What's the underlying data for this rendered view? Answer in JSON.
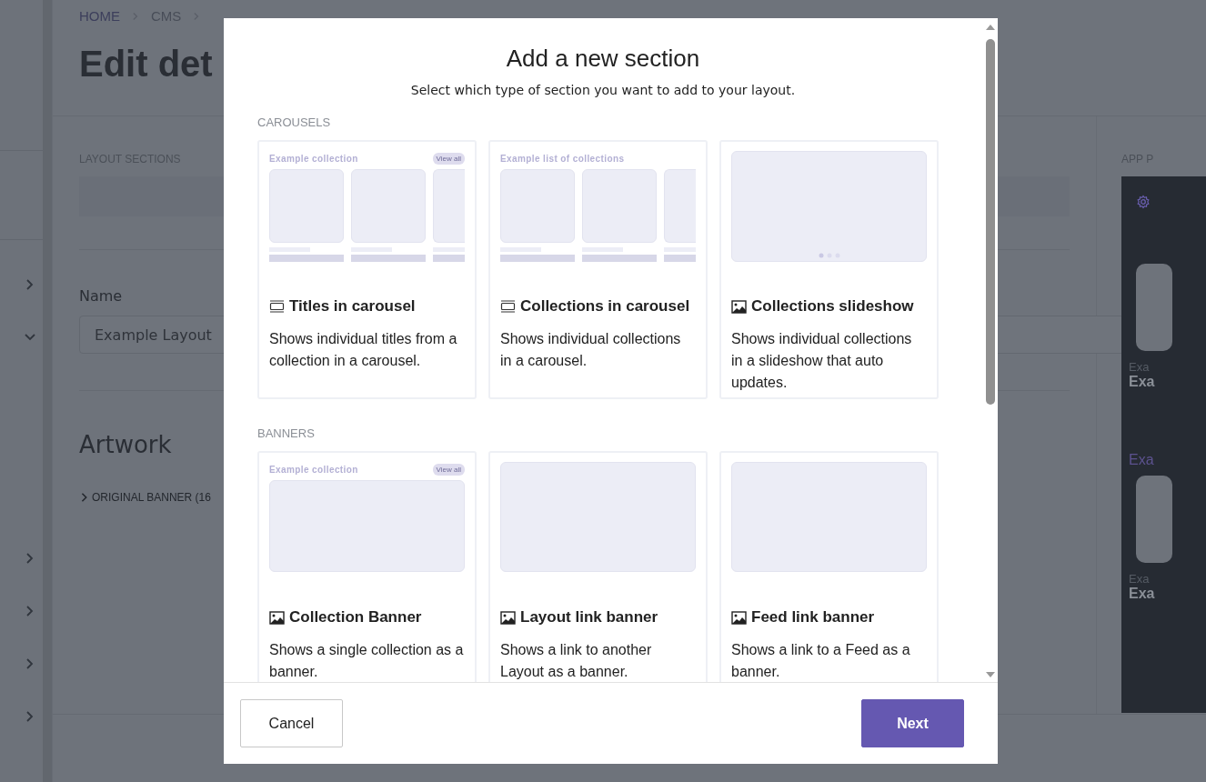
{
  "sidebar": {
    "items": [
      {
        "expanded": false
      },
      {
        "expanded": true
      },
      {
        "expanded": false
      },
      {
        "expanded": false
      },
      {
        "expanded": false
      },
      {
        "expanded": false
      }
    ]
  },
  "breadcrumbs": [
    {
      "label": "HOME",
      "link": true
    },
    {
      "label": "CMS",
      "link": false
    }
  ],
  "page_title": "Edit det",
  "layout_sections": {
    "label": "LAYOUT SECTIONS"
  },
  "name_field": {
    "label": "Name",
    "value": "Example Layout"
  },
  "artwork": {
    "heading": "Artwork",
    "items": [
      {
        "label": "ORIGINAL BANNER (16",
        "expanded": false
      }
    ]
  },
  "app_preview": {
    "label": "APP P",
    "rows": [
      {
        "kind": "tile"
      },
      {
        "kind": "caption",
        "text": "Exa"
      },
      {
        "kind": "title",
        "text": "Exa"
      },
      {
        "kind": "heading",
        "text": "Exa"
      },
      {
        "kind": "tile"
      },
      {
        "kind": "caption",
        "text": "Exa"
      },
      {
        "kind": "title",
        "text": "Exa"
      }
    ]
  },
  "modal": {
    "title": "Add a new section",
    "subtitle": "Select which type of section you want to add to your layout.",
    "groups": [
      {
        "label": "CAROUSELS",
        "sections": [
          {
            "kind": "carousel",
            "title": "Titles in carousel",
            "description": "Shows individual titles from a collection in a carousel.",
            "preview": {
              "kind": "carousel",
              "heading": "Example collection",
              "view_all": "View all"
            }
          },
          {
            "kind": "carousel",
            "title": "Collections in carousel",
            "description": "Shows individual collections in a carousel.",
            "preview": {
              "kind": "carousel",
              "heading": "Example list of collections"
            }
          },
          {
            "kind": "image",
            "title": "Collections slideshow",
            "description": "Shows individual collections in a slideshow that auto updates.",
            "preview": {
              "kind": "slideshow"
            }
          }
        ]
      },
      {
        "label": "BANNERS",
        "sections": [
          {
            "kind": "image",
            "title": "Collection Banner",
            "description": "Shows a single collection as a banner.",
            "preview": {
              "kind": "banner",
              "heading": "Example collection",
              "view_all": "View all"
            }
          },
          {
            "kind": "image",
            "title": "Layout link banner",
            "description": "Shows a link to another Layout as a banner.",
            "preview": {
              "kind": "banner"
            }
          },
          {
            "kind": "image",
            "title": "Feed link banner",
            "description": "Shows a link to a Feed as a banner.",
            "preview": {
              "kind": "banner"
            }
          }
        ]
      }
    ]
  },
  "buttons": [
    {
      "kind": "secondary",
      "label": "Cancel"
    },
    {
      "kind": "primary",
      "label": "Next"
    }
  ]
}
